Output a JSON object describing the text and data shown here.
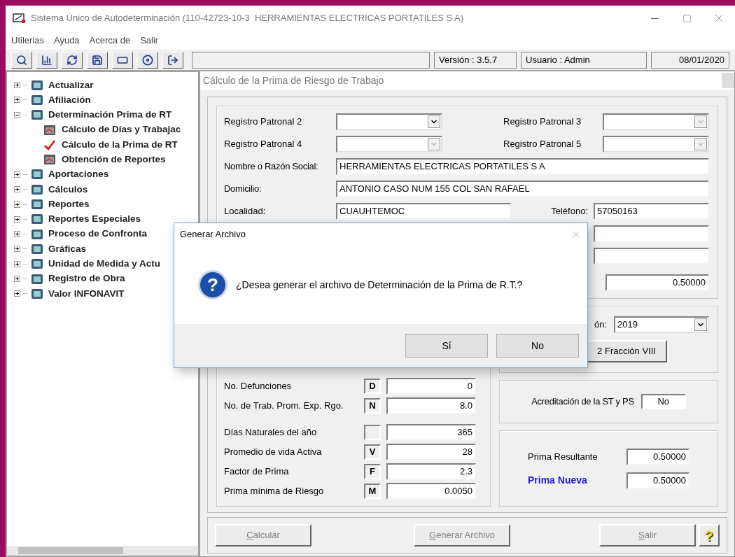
{
  "window": {
    "title": "Sistema Único de Autodeterminación (110-42723-10-3  HERRAMIENTAS ELECTRICAS PORTATILES S A)"
  },
  "menu": [
    "Utilerias",
    "Ayuda",
    "Acerca de",
    "Salir"
  ],
  "status": {
    "version": "Versión : 3.5.7",
    "user": "Usuario : Admin",
    "date": "08/01/2020"
  },
  "tree": [
    {
      "label": "Actualizar",
      "expanded": false
    },
    {
      "label": "Afiliación",
      "expanded": false
    },
    {
      "label": "Determinación Prima de RT",
      "expanded": true,
      "children": [
        {
          "label": "Cálculo de Días y Trabajac",
          "kind": "report"
        },
        {
          "label": "Cálculo de la Prima de RT",
          "kind": "check"
        },
        {
          "label": "Obtención de Reportes",
          "kind": "report"
        }
      ]
    },
    {
      "label": "Aportaciones",
      "expanded": false
    },
    {
      "label": "Cálculos",
      "expanded": false
    },
    {
      "label": "Reportes",
      "expanded": false
    },
    {
      "label": "Reportes Especiales",
      "expanded": false
    },
    {
      "label": "Proceso de Confronta",
      "expanded": false
    },
    {
      "label": "Gráficas",
      "expanded": false
    },
    {
      "label": "Unidad de Medida y Actu",
      "expanded": false
    },
    {
      "label": "Registro de Obra",
      "expanded": false
    },
    {
      "label": "Valor INFONAVIT",
      "expanded": false
    }
  ],
  "child_window": {
    "title": "Cálculo de la Prima de Riesgo de Trabajo",
    "registros": [
      {
        "label": "Registro Patronal 2",
        "disabled": false
      },
      {
        "label": "Registro Patronal 3",
        "disabled": true
      },
      {
        "label": "Registro Patronal 4",
        "disabled": true
      },
      {
        "label": "Registro Patronal 5",
        "disabled": true
      }
    ],
    "nombre": {
      "label": "Nombre o Razón Social:",
      "value": "HERRAMIENTAS ELECTRICAS PORTATILES S A"
    },
    "domicilio": {
      "label": "Domicilio:",
      "value": "ANTONIO CASO NUM 155 COL SAN RAFAEL"
    },
    "localidad": {
      "label": "Localidad:",
      "value": "CUAUHTEMOC"
    },
    "telefono": {
      "label": "Teléfono:",
      "value": "57050163"
    },
    "prima_anterior": "0.50000",
    "year_label": "ón:",
    "year": "2019",
    "fraccion_button": "2 Fracción VIII",
    "factors": [
      {
        "label": "No. Defunciones",
        "letter": "D",
        "value": "0"
      },
      {
        "label": "No. de Trab. Prom. Exp. Rgo.",
        "letter": "N",
        "value": "8.0"
      },
      {
        "label": "Días Naturales del año",
        "value": "365"
      },
      {
        "label": "Promedio de vida Activa",
        "letter": "V",
        "value": "28"
      },
      {
        "label": "Factor de Prima",
        "letter": "F",
        "value": "2.3"
      },
      {
        "label": "Prima mínima de Riesgo",
        "letter": "M",
        "value": "0.0050"
      }
    ],
    "acreditacion": {
      "label": "Acreditación de la ST y PS",
      "value": "No"
    },
    "prima_resultante": {
      "label": "Prima Resultante",
      "value": "0.50000"
    },
    "prima_nueva": {
      "label": "Prima Nueva",
      "value": "0.50000"
    },
    "buttons": [
      {
        "label": "Calcular",
        "disabled": true
      },
      {
        "label": "Generar Archivo",
        "disabled": true
      },
      {
        "label": "Salir",
        "disabled": true
      }
    ],
    "help": "?"
  },
  "dialog": {
    "title": "Generar Archivo",
    "icon": "?",
    "message": "¿Desea generar el archivo de Determinación de la Prima de R.T.?",
    "buttons": [
      "Sí",
      "No"
    ]
  }
}
